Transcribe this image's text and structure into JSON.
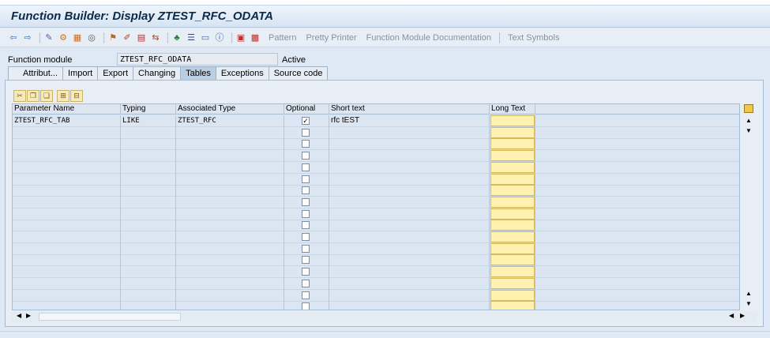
{
  "window": {
    "title": "Function Builder: Display ZTEST_RFC_ODATA"
  },
  "toolbar": {
    "icons": [
      "back-arrow-icon",
      "forward-arrow-icon",
      "other-object-icon",
      "display-change-icon",
      "activate-icon",
      "test-icon",
      "where-used-icon",
      "edit-icon",
      "object-list-icon",
      "navigation-icon",
      "hierarchy-icon",
      "enhance-icon",
      "fullscreen-icon",
      "info-icon",
      "function-docu-icon",
      "pattern-icon"
    ],
    "pattern": "Pattern",
    "pretty_printer": "Pretty Printer",
    "fm_documentation": "Function Module Documentation",
    "text_symbols": "Text Symbols"
  },
  "function_module": {
    "label": "Function module",
    "value": "ZTEST_RFC_ODATA",
    "status": "Active"
  },
  "tabs": [
    "Attribut...",
    "Import",
    "Export",
    "Changing",
    "Tables",
    "Exceptions",
    "Source code"
  ],
  "active_tab": "Tables",
  "grid": {
    "columns": [
      "Parameter Name",
      "Typing",
      "Associated Type",
      "Optional",
      "Short text",
      "Long Text"
    ],
    "rows": [
      {
        "param": "ZTEST_RFC_TAB",
        "typing": "LIKE",
        "assoc": "ZTEST_RFC",
        "optional": "✓",
        "short_text": "rfc tEST"
      }
    ]
  },
  "colors": {
    "accent": "#b9cde3",
    "long_text": "#fff1b0",
    "background": "#dfe9f5"
  }
}
